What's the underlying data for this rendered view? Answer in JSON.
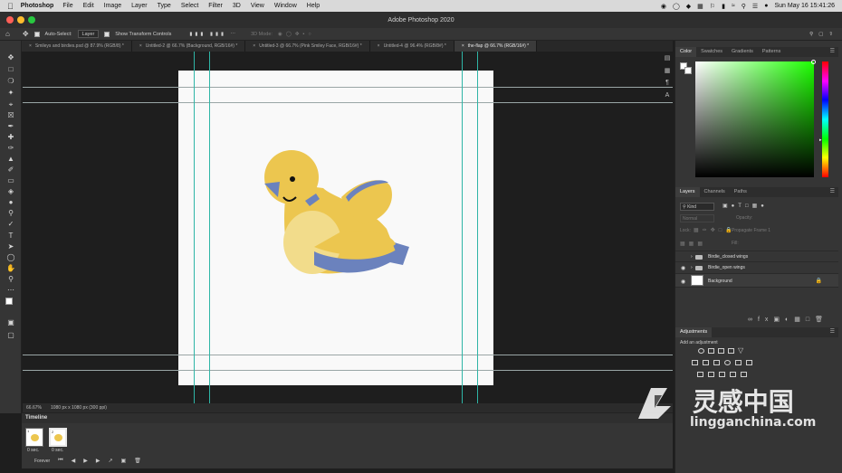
{
  "menubar": {
    "app": "Photoshop",
    "items": [
      "File",
      "Edit",
      "Image",
      "Layer",
      "Type",
      "Select",
      "Filter",
      "3D",
      "View",
      "Window",
      "Help"
    ],
    "clock": "Sun May 16  15:41:26"
  },
  "window": {
    "title": "Adobe Photoshop 2020"
  },
  "options": {
    "auto_select_label": "Auto-Select:",
    "auto_select_value": "Layer",
    "transform_label": "Show Transform Controls",
    "mode_3d": "3D Mode:"
  },
  "tabs": [
    "Smileys and birdies.psd @ 87.9% (RGB/8) *",
    "Untitled-2 @ 66.7% (Background, RGB/16#) *",
    "Untitled-3 @ 66.7% (Pink Smiley Face, RGB/16#) *",
    "Untitled-4 @ 96.4% (RGB/8#) *",
    "the-flap @ 66.7% (RGB/16#) *"
  ],
  "status": {
    "zoom": "66.67%",
    "dimensions": "1080 px x 1080 px (300 ppi)"
  },
  "timeline": {
    "title": "Timeline",
    "frames": [
      {
        "num": "1",
        "time": "0 sec."
      },
      {
        "num": "2",
        "time": "0 sec."
      }
    ],
    "loop": "Forever"
  },
  "color_panel": {
    "tabs": [
      "Color",
      "Swatches",
      "Gradients",
      "Patterns"
    ],
    "hue_color": "#1cff00"
  },
  "layers_panel": {
    "tabs": [
      "Layers",
      "Channels",
      "Paths"
    ],
    "filter_kind": "Kind",
    "blend_mode": "Normal",
    "opacity_label": "Opacity:",
    "lock_label": "Lock:",
    "fill_label": "Fill:",
    "propagate": "Propagate Frame 1",
    "layers": [
      {
        "name": "Birdie_closed wings",
        "type": "group",
        "visible": false
      },
      {
        "name": "Birdie_open wings",
        "type": "group",
        "visible": true
      },
      {
        "name": "Background",
        "type": "layer",
        "visible": true
      }
    ]
  },
  "adjustments_panel": {
    "title": "Adjustments",
    "hint": "Add an adjustment"
  },
  "watermark": {
    "cn": "灵感中国",
    "en": "lingganchina.com"
  }
}
